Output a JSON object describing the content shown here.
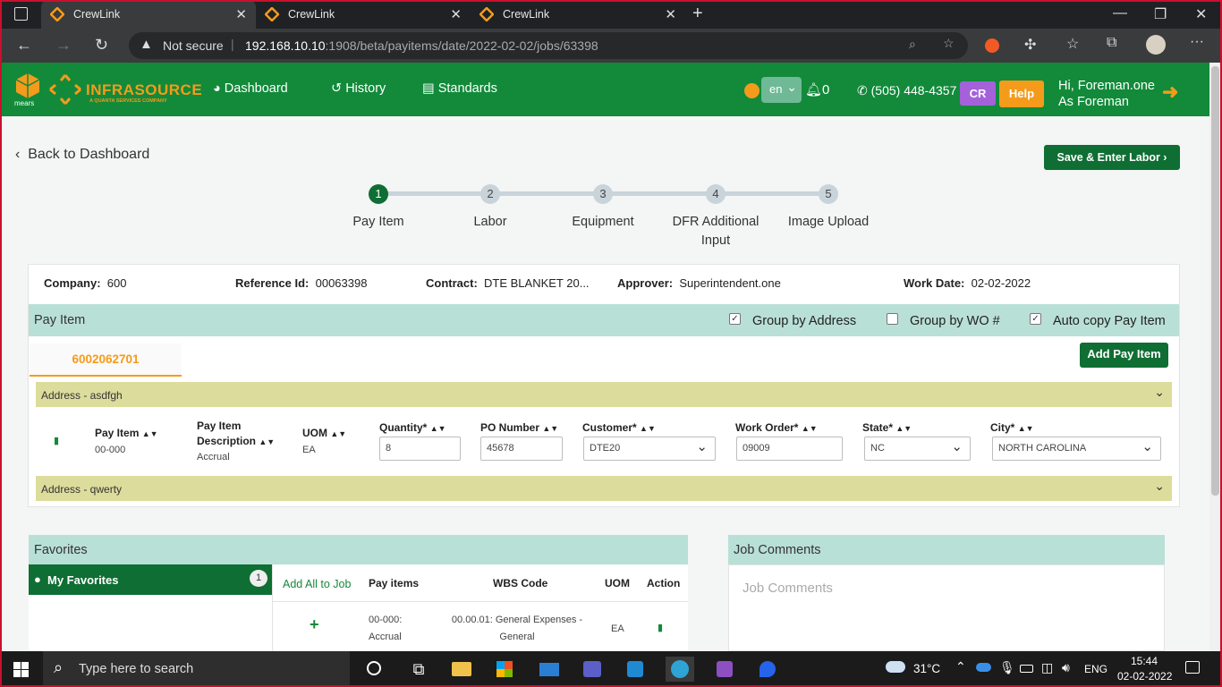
{
  "browser": {
    "tabs": [
      {
        "title": "CrewLink"
      },
      {
        "title": "CrewLink"
      },
      {
        "title": "CrewLink"
      }
    ],
    "security": "Not secure",
    "url_host": "192.168.10.10",
    "url_path": ":1908/beta/payitems/date/2022-02-02/jobs/63398"
  },
  "header": {
    "brand": "INFRASOURCE",
    "brand_sub": "A QUANTA SERVICES COMPANY",
    "brand_small": "mears",
    "nav": [
      {
        "label": "Dashboard"
      },
      {
        "label": "History"
      },
      {
        "label": "Standards"
      }
    ],
    "language": "en",
    "notifications": "0",
    "phone": "(505) 448-4357",
    "cr_label": "CR",
    "help_label": "Help",
    "greeting": "Hi, Foreman.one",
    "role": "As Foreman"
  },
  "page": {
    "back_label": "Back to Dashboard",
    "save_button": "Save & Enter Labor ›",
    "steps": [
      {
        "num": "1",
        "label": "Pay Item"
      },
      {
        "num": "2",
        "label": "Labor"
      },
      {
        "num": "3",
        "label": "Equipment"
      },
      {
        "num": "4",
        "label": "DFR Additional Input"
      },
      {
        "num": "5",
        "label": "Image Upload"
      }
    ],
    "current_step": 1
  },
  "job_info": {
    "company_label": "Company:",
    "company": "600",
    "reference_label": "Reference Id:",
    "reference": "00063398",
    "contract_label": "Contract:",
    "contract": "DTE BLANKET 20...",
    "approver_label": "Approver:",
    "approver": "Superintendent.one",
    "work_date_label": "Work Date:",
    "work_date": "02-02-2022"
  },
  "pay_item": {
    "title": "Pay Item",
    "group_by_address": {
      "label": "Group by Address",
      "checked": true
    },
    "group_by_wo": {
      "label": "Group by WO #",
      "checked": false
    },
    "auto_copy": {
      "label": "Auto copy Pay Item",
      "checked": true
    },
    "wo_tab": "6002062701",
    "add_button": "Add Pay Item",
    "address_1": "Address - asdfgh",
    "address_2": "Address - qwerty",
    "columns": {
      "pay_item": "Pay Item",
      "description_1": "Pay Item",
      "description_2": "Description",
      "uom": "UOM",
      "quantity": "Quantity*",
      "po_number": "PO Number",
      "customer": "Customer*",
      "work_order": "Work Order*",
      "state": "State*",
      "city": "City*"
    },
    "row": {
      "pay_item": "00-000",
      "description": "Accrual",
      "uom": "EA",
      "quantity": "8",
      "po_number": "45678",
      "customer": "DTE20",
      "work_order": "09009",
      "state": "NC",
      "city": "NORTH CAROLINA"
    }
  },
  "favorites": {
    "title": "Favorites",
    "my_favorites": "My Favorites",
    "count": "1",
    "add_all": "Add All to Job",
    "columns": {
      "pay_items": "Pay items",
      "wbs_code": "WBS Code",
      "uom": "UOM",
      "action": "Action"
    },
    "rows": [
      {
        "pay_item_1": "00-000:",
        "pay_item_2": "Accrual",
        "wbs_1": "00.00.01: General Expenses -",
        "wbs_2": "General",
        "uom": "EA"
      }
    ]
  },
  "job_comments": {
    "title": "Job Comments",
    "placeholder": "Job Comments"
  },
  "taskbar": {
    "search_placeholder": "Type here to search",
    "weather": "31°C",
    "language": "ENG",
    "time": "15:44",
    "date": "02-02-2022"
  },
  "colors": {
    "brand_green": "#128a3a",
    "orange": "#f59b1b",
    "purple": "#a561d9",
    "teal_panel": "#b9e0d6",
    "address_bar": "#dcdc9c"
  }
}
